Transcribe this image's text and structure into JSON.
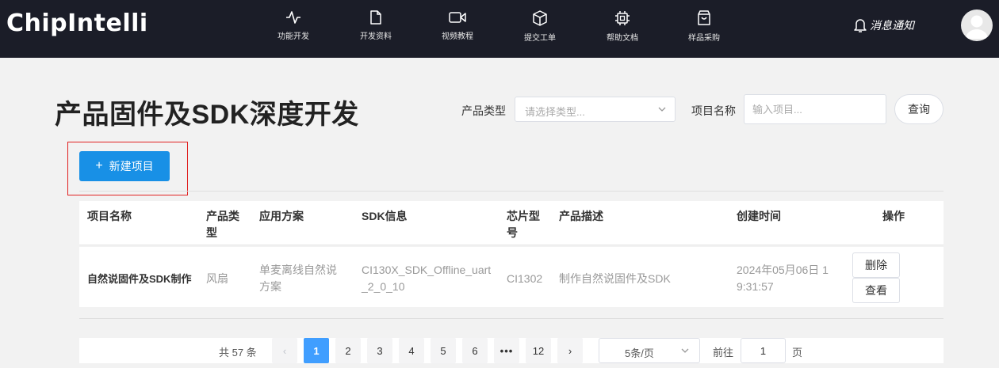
{
  "brand": "ChipIntelli",
  "nav": [
    {
      "label": "功能开发",
      "icon": "activity-icon"
    },
    {
      "label": "开发资料",
      "icon": "file-icon"
    },
    {
      "label": "视频教程",
      "icon": "video-icon"
    },
    {
      "label": "提交工单",
      "icon": "box-icon"
    },
    {
      "label": "帮助文档",
      "icon": "chip-icon"
    },
    {
      "label": "样品采购",
      "icon": "shopping-bag-icon"
    }
  ],
  "notice_label": "消息通知",
  "page_title": "产品固件及SDK深度开发",
  "filters": {
    "type_label": "产品类型",
    "type_placeholder": "请选择类型...",
    "name_label": "项目名称",
    "name_placeholder": "输入项目...",
    "search_label": "查询"
  },
  "new_project_label": "新建项目",
  "table": {
    "headers": [
      "项目名称",
      "产品类型",
      "应用方案",
      "SDK信息",
      "芯片型号",
      "产品描述",
      "创建时间",
      "操作"
    ],
    "rows": [
      {
        "name": "自然说固件及SDK制作",
        "type": "风扇",
        "solution": "单麦离线自然说方案",
        "sdk": "CI130X_SDK_Offline_uart_2_0_10",
        "chip": "CI1302",
        "desc": "制作自然说固件及SDK",
        "created": "2024年05月06日 19:31:57",
        "actions": [
          "删除",
          "查看"
        ]
      }
    ]
  },
  "pagination": {
    "total_text": "共 57 条",
    "pages": [
      "1",
      "2",
      "3",
      "4",
      "5",
      "6",
      "•••",
      "12"
    ],
    "current": "1",
    "prev": "‹",
    "next": "›",
    "page_size": "5条/页",
    "goto_label": "前往",
    "goto_value": "1",
    "page_unit": "页"
  },
  "colors": {
    "topbar": "#1b1d28",
    "primary_button": "#1890e6",
    "active_page": "#409eff",
    "highlight_border": "#e02020"
  }
}
